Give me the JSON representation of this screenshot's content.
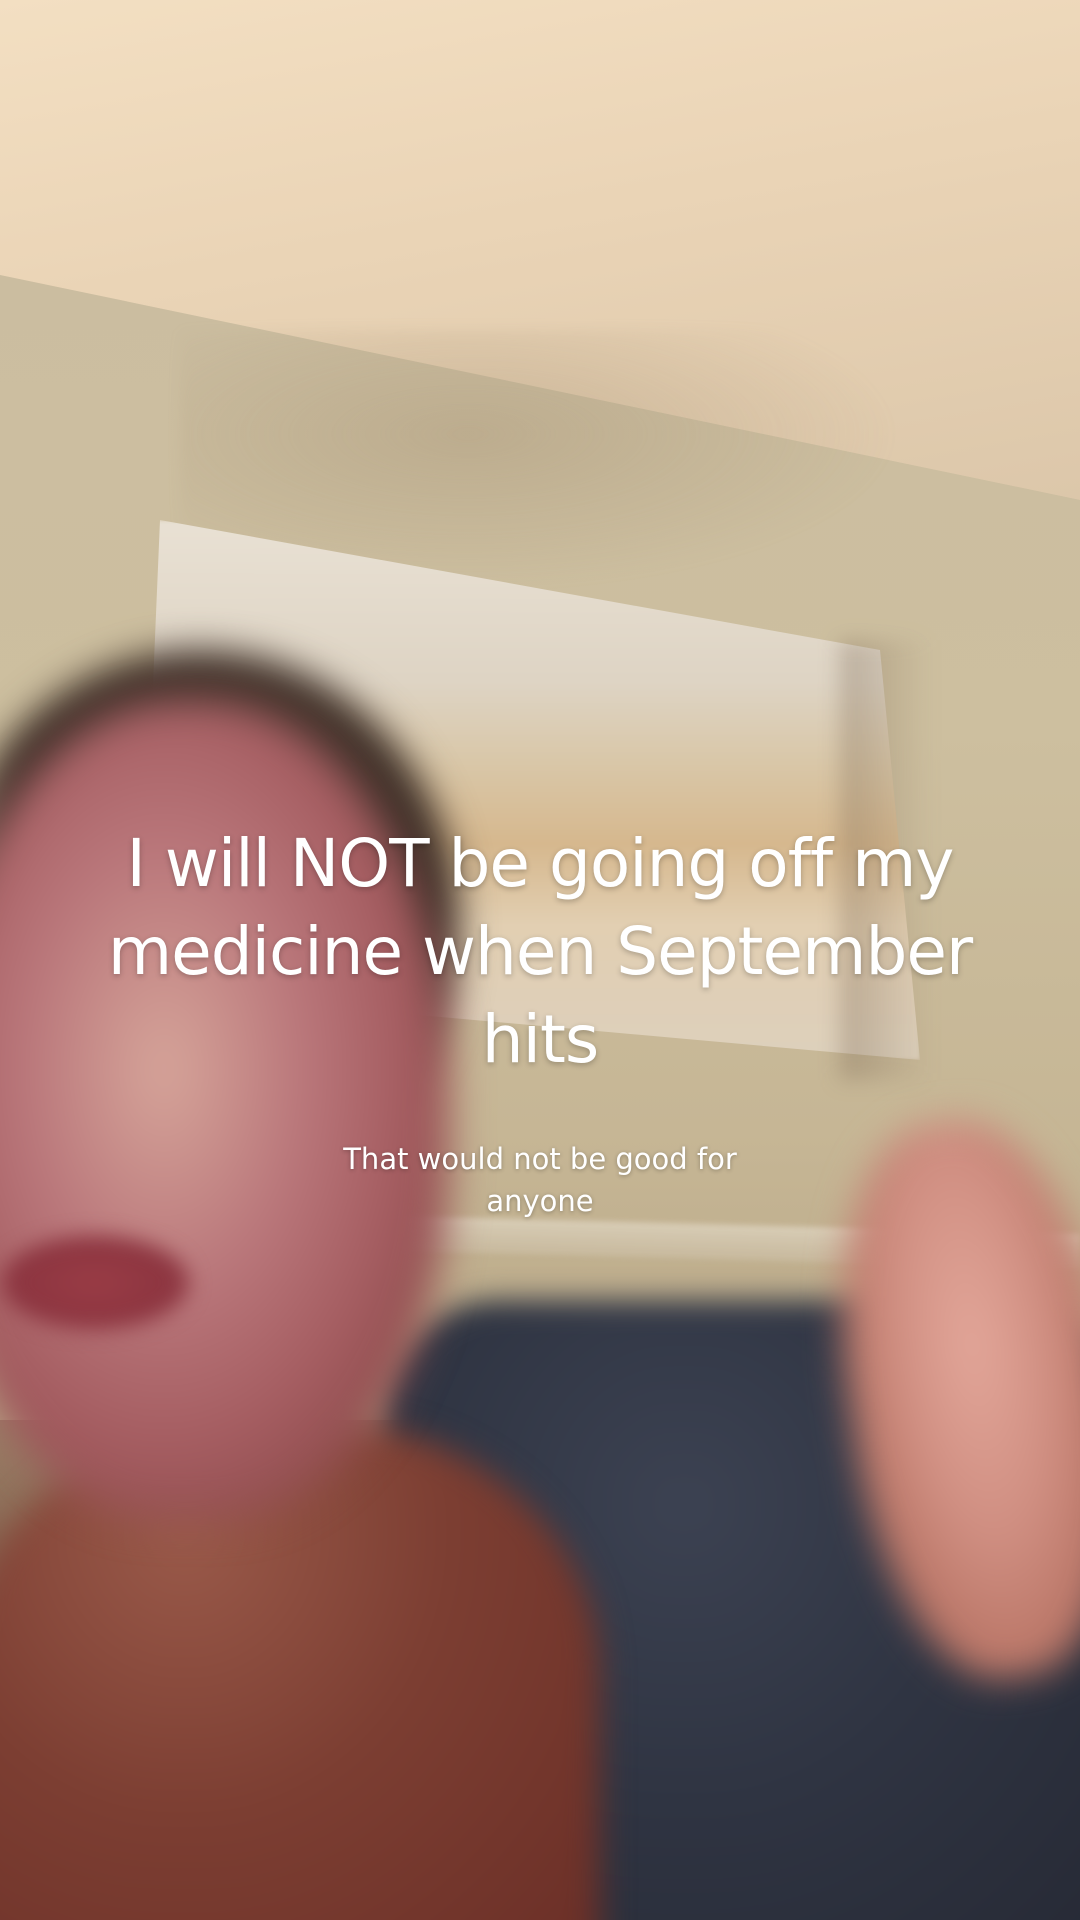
{
  "video": {
    "caption_main": "I will NOT be going off my medicine when September hits",
    "caption_sub": "That would not be good for anyone"
  }
}
